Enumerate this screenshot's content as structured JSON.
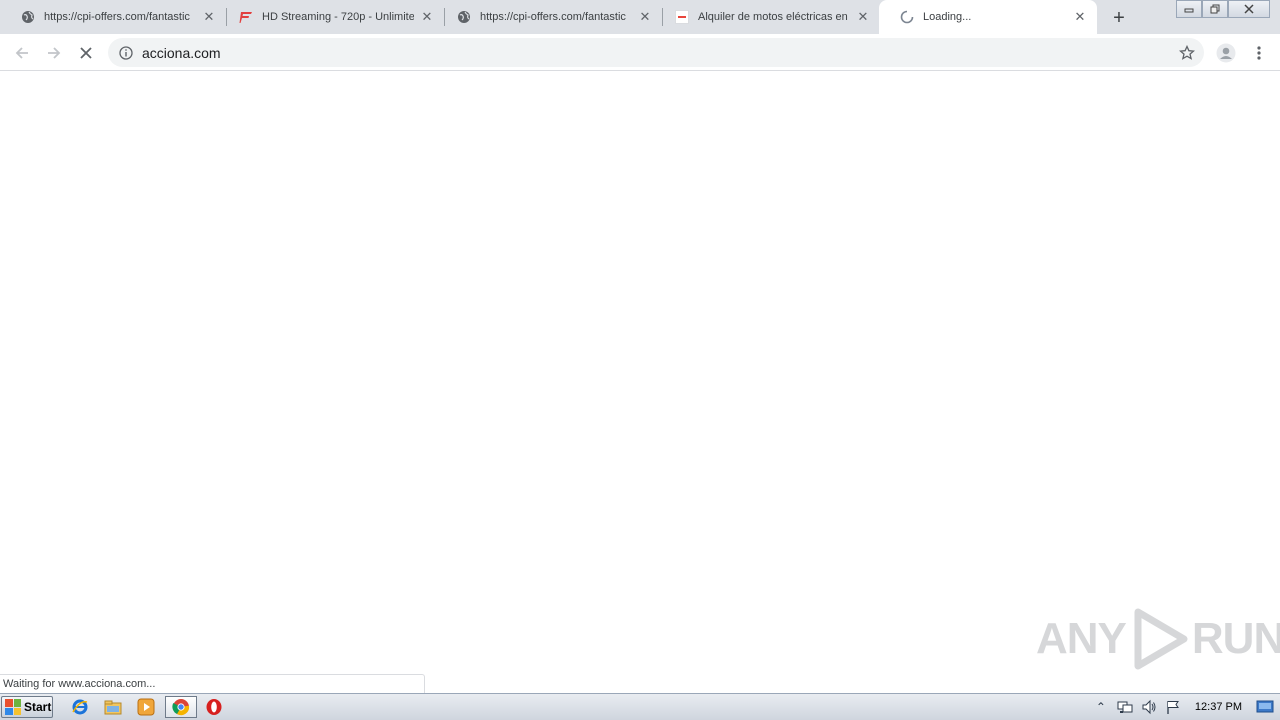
{
  "browser": {
    "tabs": [
      {
        "title": "https://cpi-offers.com/fantastic",
        "favicon": "globe-icon"
      },
      {
        "title": "HD Streaming - 720p - Unlimited",
        "favicon": "streaming-logo-icon"
      },
      {
        "title": "https://cpi-offers.com/fantastic",
        "favicon": "globe-icon"
      },
      {
        "title": "Alquiler de motos eléctricas en M",
        "favicon": "site-favicon-icon"
      },
      {
        "title": "Loading...",
        "favicon": "loading-spinner-icon"
      }
    ],
    "new_tab_icon": "plus-icon",
    "address": "acciona.com",
    "status_text": "Waiting for www.acciona.com..."
  },
  "watermark": {
    "left": "ANY",
    "right": "RUN"
  },
  "taskbar": {
    "start_label": "Start",
    "pinned": [
      "ie-icon",
      "explorer-icon",
      "media-player-icon",
      "chrome-icon",
      "opera-icon"
    ],
    "clock": "12:37 PM"
  },
  "colors": {
    "tabstrip": "#dee1e6",
    "omnibox": "#f1f3f4",
    "taskbar": "#cfd5de"
  }
}
